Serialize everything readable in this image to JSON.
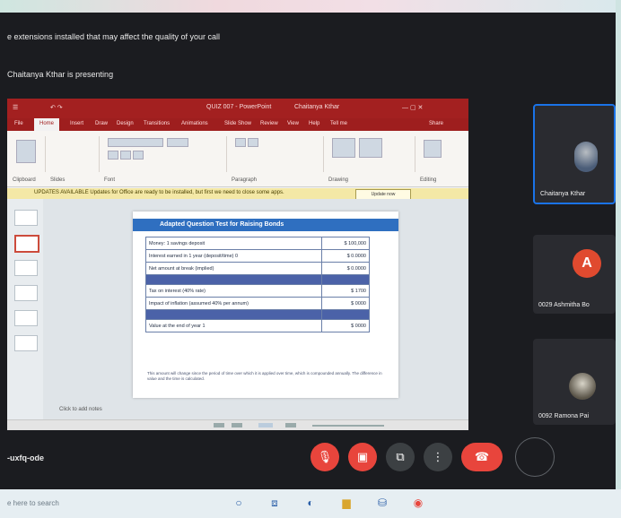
{
  "banner": {
    "extensions_notice": "e extensions installed that may affect the quality of your call",
    "presenting": "Chaitanya Kthar is presenting"
  },
  "shared_screen": {
    "app_title": "QUIZ 007 - PowerPoint",
    "user": "Chaitanya Kthar",
    "tabs": [
      "File",
      "Home",
      "Insert",
      "Draw",
      "Design",
      "Transitions",
      "Animations",
      "Slide Show",
      "Review",
      "View",
      "Help",
      "Tell me"
    ],
    "active_tab": "Home",
    "share_label": "Share",
    "ribbon_groups": [
      "Clipboard",
      "Slides",
      "Font",
      "Paragraph",
      "Drawing",
      "Editing"
    ],
    "info_bar": "UPDATES AVAILABLE  Updates for Office are ready to be installed, but first we need to close some apps.",
    "info_button": "Update now",
    "slide_title": "Adapted Question Test for Raising Bonds",
    "slide_table": [
      {
        "label": "Money: 1 savings deposit",
        "value": "$ 100,000"
      },
      {
        "label": "Interest earned in 1 year (deposit/time) 0",
        "value": "$ 0.0000"
      },
      {
        "label": "Net amount at break (implied)",
        "value": "$ 0.0000"
      },
      {
        "label": "",
        "value": ""
      },
      {
        "label": "Tax on interest (40% rate)",
        "value": "$ 1700"
      },
      {
        "label": "Impact of inflation (assumed 40% per annum)",
        "value": "$ 0000"
      },
      {
        "label": "",
        "value": ""
      },
      {
        "label": "Value at the end of year 1",
        "value": "$ 0000"
      }
    ],
    "slide_note": "This amount will change since the period of time over which it is applied over time, which is compounded annually. The difference in value and the time is calculated.",
    "click_notes": "Click to add notes"
  },
  "participants": [
    {
      "name": "Chaitanya Kthar",
      "avatar": "photo",
      "active": true
    },
    {
      "name": "0029 Ashmitha Bo",
      "avatar": "A",
      "active": false
    },
    {
      "name": "0092 Ramona Pai",
      "avatar": "photo",
      "active": false
    }
  ],
  "meeting": {
    "code": "-uxfq-ode",
    "controls": [
      "mic-off-icon",
      "camera-off-icon",
      "present-icon",
      "more-icon",
      "end-call-icon"
    ]
  },
  "taskbar": {
    "search_placeholder": "e here to search"
  },
  "colors": {
    "ribbon": "#a32020",
    "accent_blue": "#1a73e8",
    "control_red": "#e8453c",
    "dark_bg": "#1b1c20"
  }
}
